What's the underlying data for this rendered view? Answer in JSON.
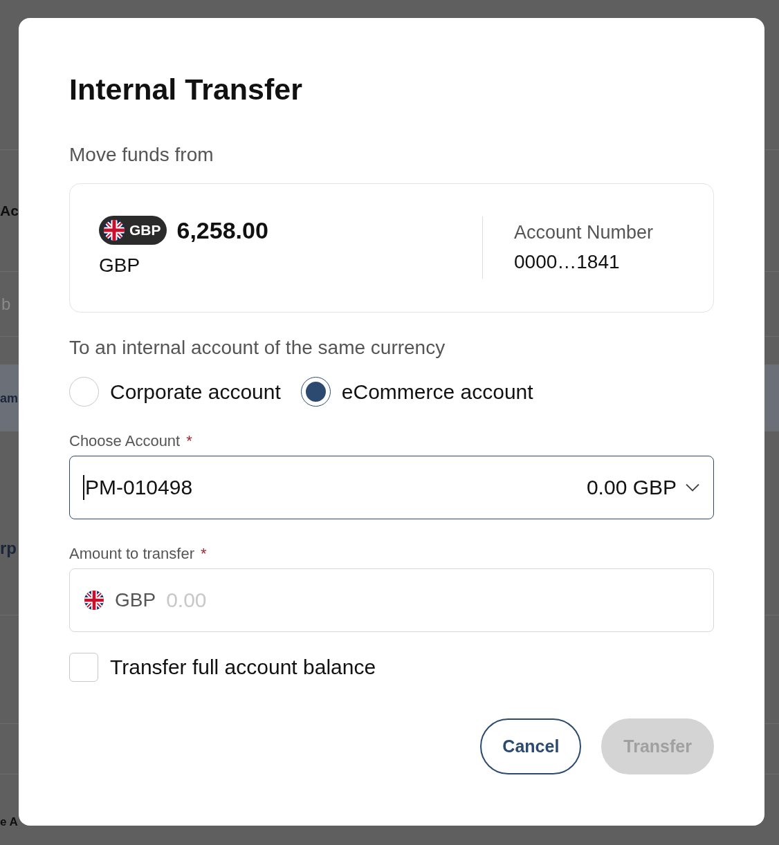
{
  "background": {
    "heading": "Ac",
    "search_placeholder": "b",
    "rows": [
      {
        "text": "am",
        "selected": true
      },
      {
        "text": "rp",
        "selected": false
      }
    ],
    "footer": "e A"
  },
  "dialog": {
    "title": "Internal Transfer",
    "source_label": "Move funds from",
    "source_account": {
      "badge": "GBP",
      "balance": "6,258.00",
      "currency": "GBP",
      "number_label": "Account Number",
      "number": "0000…1841"
    },
    "destination_label": "To an internal account of the same currency",
    "account_types": [
      {
        "label": "Corporate account",
        "selected": false
      },
      {
        "label": "eCommerce account",
        "selected": true
      }
    ],
    "choose_account": {
      "label": "Choose Account",
      "required_mark": "*",
      "value": "PM-010498",
      "balance": "0.00 GBP",
      "focused": true
    },
    "amount": {
      "label": "Amount to transfer",
      "required_mark": "*",
      "currency": "GBP",
      "placeholder": "0.00"
    },
    "full_balance": {
      "label": "Transfer full account balance",
      "checked": false
    },
    "buttons": [
      {
        "label": "Cancel",
        "kind": "secondary",
        "disabled": false
      },
      {
        "label": "Transfer",
        "kind": "primary",
        "disabled": true
      }
    ]
  }
}
